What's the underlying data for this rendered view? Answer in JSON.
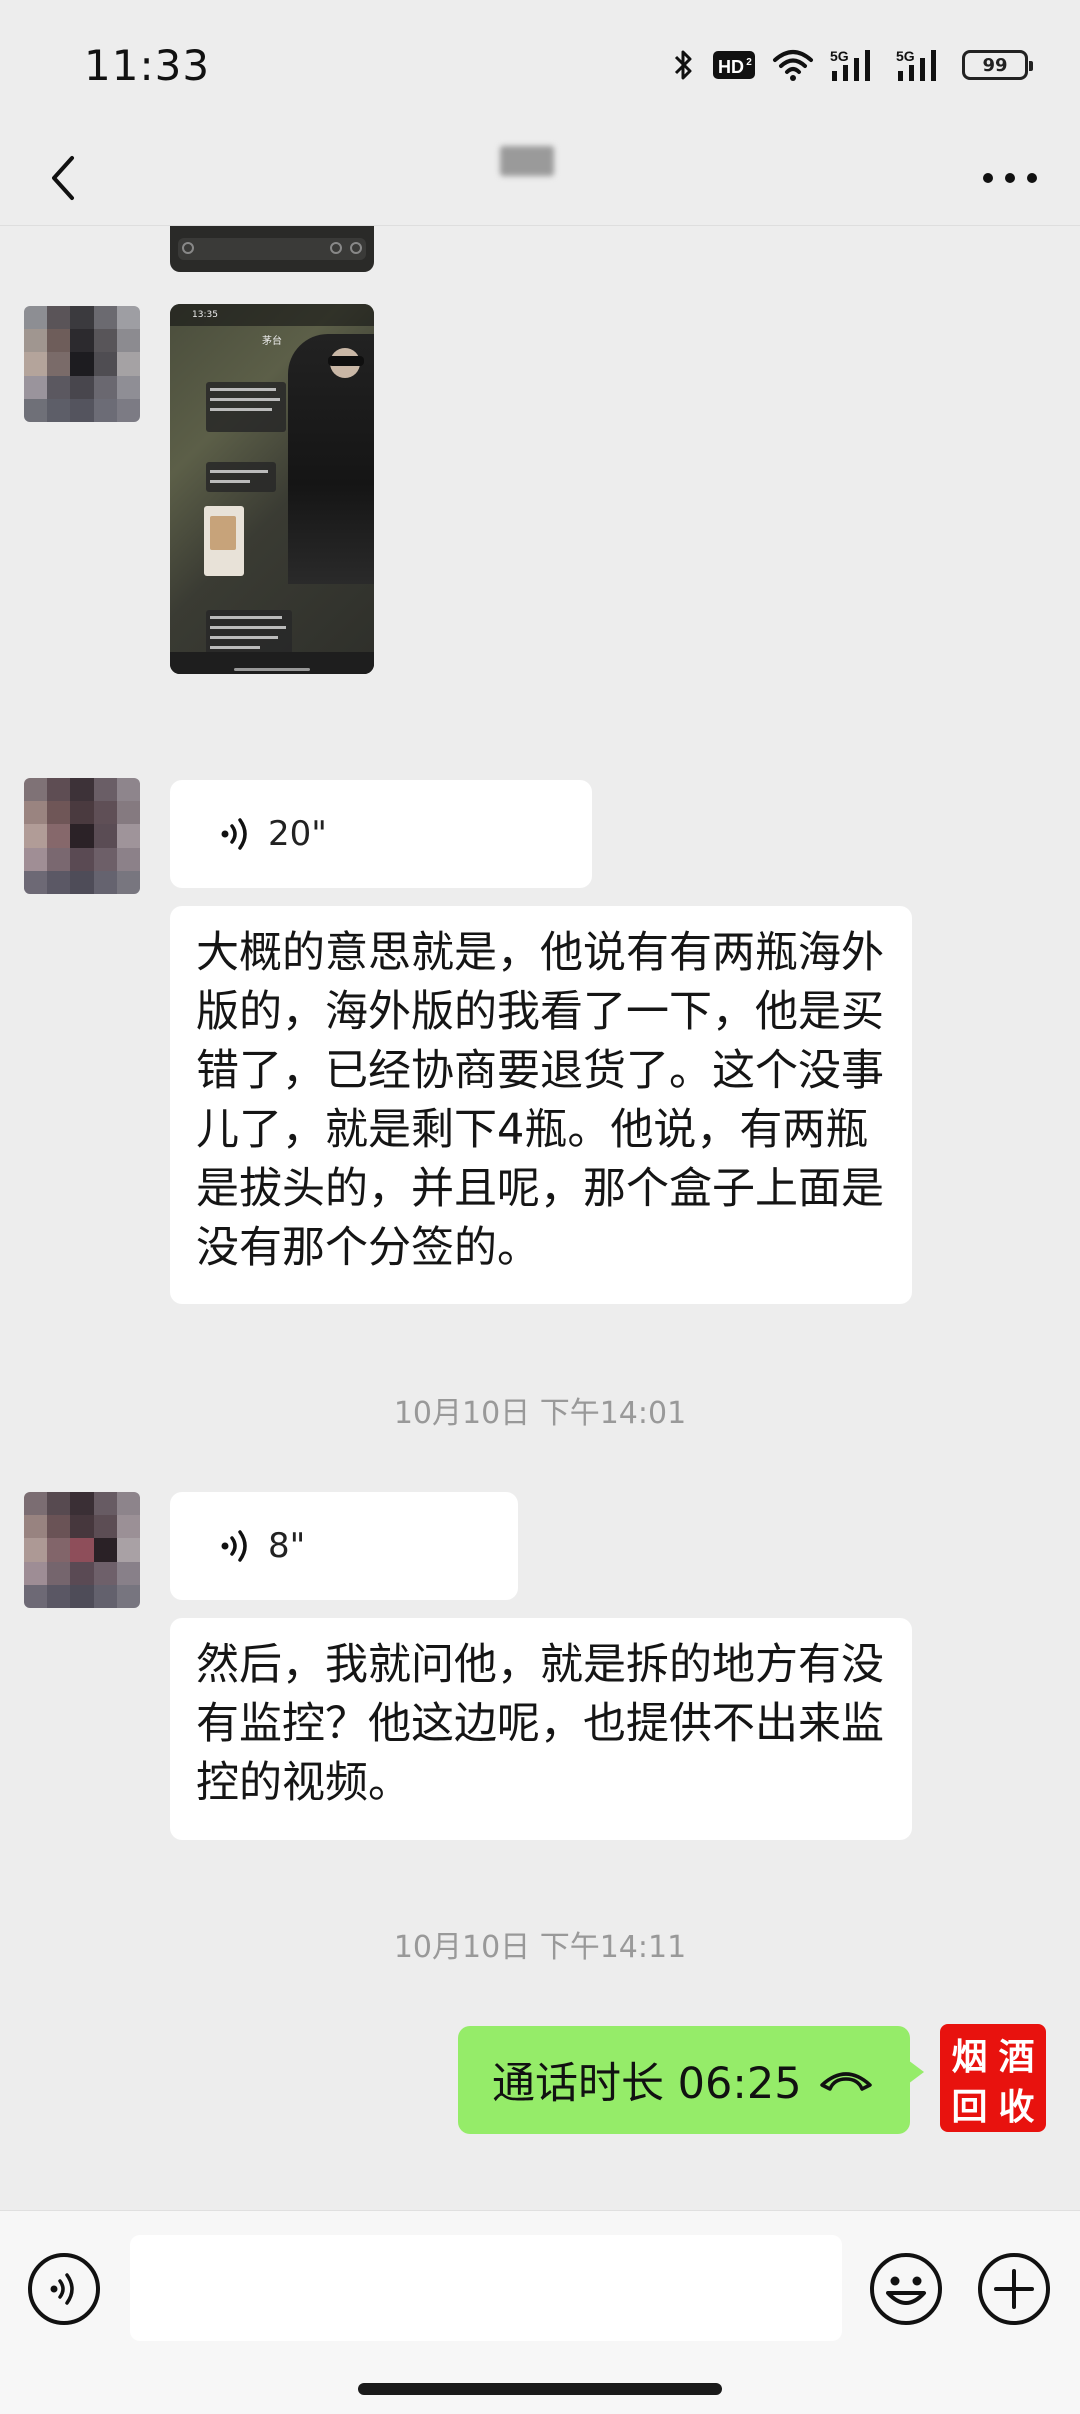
{
  "status_bar": {
    "time": "11:33",
    "hd_label": "HD",
    "signal1": "5G",
    "signal2": "5G",
    "battery": "99"
  },
  "nav": {
    "back_icon": "chevron-left-icon",
    "more_icon": "more-dots-icon"
  },
  "messages": {
    "voice1": {
      "duration": "20\""
    },
    "text1": "大概的意思就是，他说有有两瓶海外版的，海外版的我看了一下，他是买错了，已经协商要退货了。这个没事儿了，就是剩下4瓶。他说，有两瓶是拔头的，并且呢，那个盒子上面是没有那个分签的。",
    "timestamp1": "10月10日 下午14:01",
    "voice2": {
      "duration": "8\""
    },
    "text2": "然后，我就问他，就是拆的地方有没有监控？他这边呢，也提供不出来监控的视频。",
    "timestamp2": "10月10日 下午14:11",
    "call": {
      "label": "通话时长 06:25"
    },
    "my_avatar": {
      "line1": "烟酒",
      "line2": "回收",
      "chars": [
        "烟",
        "酒",
        "回",
        "收"
      ]
    }
  },
  "thumbnail": {
    "time": "13:35",
    "title": "茅台"
  },
  "input": {
    "voice_icon": "voice-input-icon",
    "emoji_icon": "emoji-icon",
    "plus_icon": "plus-icon"
  },
  "colors": {
    "background": "#ededed",
    "bubble_incoming": "#ffffff",
    "bubble_outgoing": "#95ec69",
    "logo_red": "#e8120e"
  }
}
